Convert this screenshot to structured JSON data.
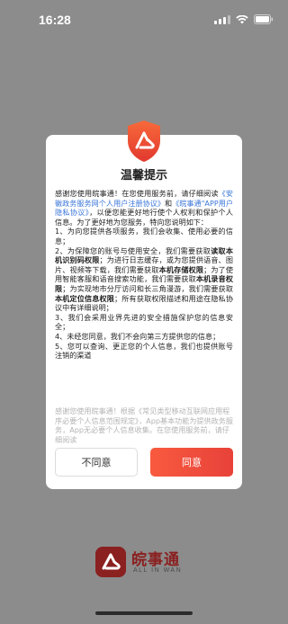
{
  "status_bar": {
    "time": "16:28"
  },
  "dialog": {
    "title": "温馨提示",
    "intro_1": "感谢您使用皖事通！在您使用服务前，请仔细阅读",
    "link_1": "《安徽政务服务网个人用户注册协议》",
    "intro_2": "和",
    "link_2": "《皖事通\"APP用户隐私协议》",
    "intro_3": "，以便您能更好地行使个人权利和保护个人信息。为了更好地为您服务，特向您说明如下：",
    "item_1": "1、为向您提供各项服务，我们会收集、使用必要的信息；",
    "item_2a": "2、为保障您的账号与使用安全，我们需要获取",
    "item_2b": "读取本机识别码权限",
    "item_2c": "；为进行日志缓存，或为您提供语音、图片、视频等下载，我们需要获取",
    "item_2d": "本机存储权限",
    "item_2e": "；为了使用智能客服和语音搜索功能，我们需要获取",
    "item_2f": "本机录音权限",
    "item_2g": "；为实现地市分厅访问和长三角漫游，我们需要获取",
    "item_2h": "本机定位信息权限",
    "item_2i": "；所有获取权限描述和用途在隐私协议中有详细说明；",
    "item_3": "3、我们会采用业界先进的安全措施保护您的信息安全；",
    "item_4": "4、未经您同意，我们不会向第三方提供您的信息；",
    "item_5": "5、您可以查询、更正您的个人信息，我们也提供账号注销的渠道",
    "faded_text": "感谢您使用皖事通！根据《常见类型移动互联网应用程序必要个人信息范围规定》，App基本功能为提供政务服务，App无必要个人信息收集。在您使用服务前，请仔细阅读",
    "disagree_label": "不同意",
    "agree_label": "同意"
  },
  "brand": {
    "name": "皖事通",
    "subtitle": "ALL IN WAN"
  },
  "colors": {
    "overlay": "#8c8c8c",
    "accent_red": "#e8423a",
    "link_blue": "#3a76d8",
    "brand_dark_red": "#8a2020"
  },
  "icons": [
    "signal-icon",
    "wifi-icon",
    "battery-icon",
    "shield-logo-icon",
    "brand-logo-icon"
  ]
}
